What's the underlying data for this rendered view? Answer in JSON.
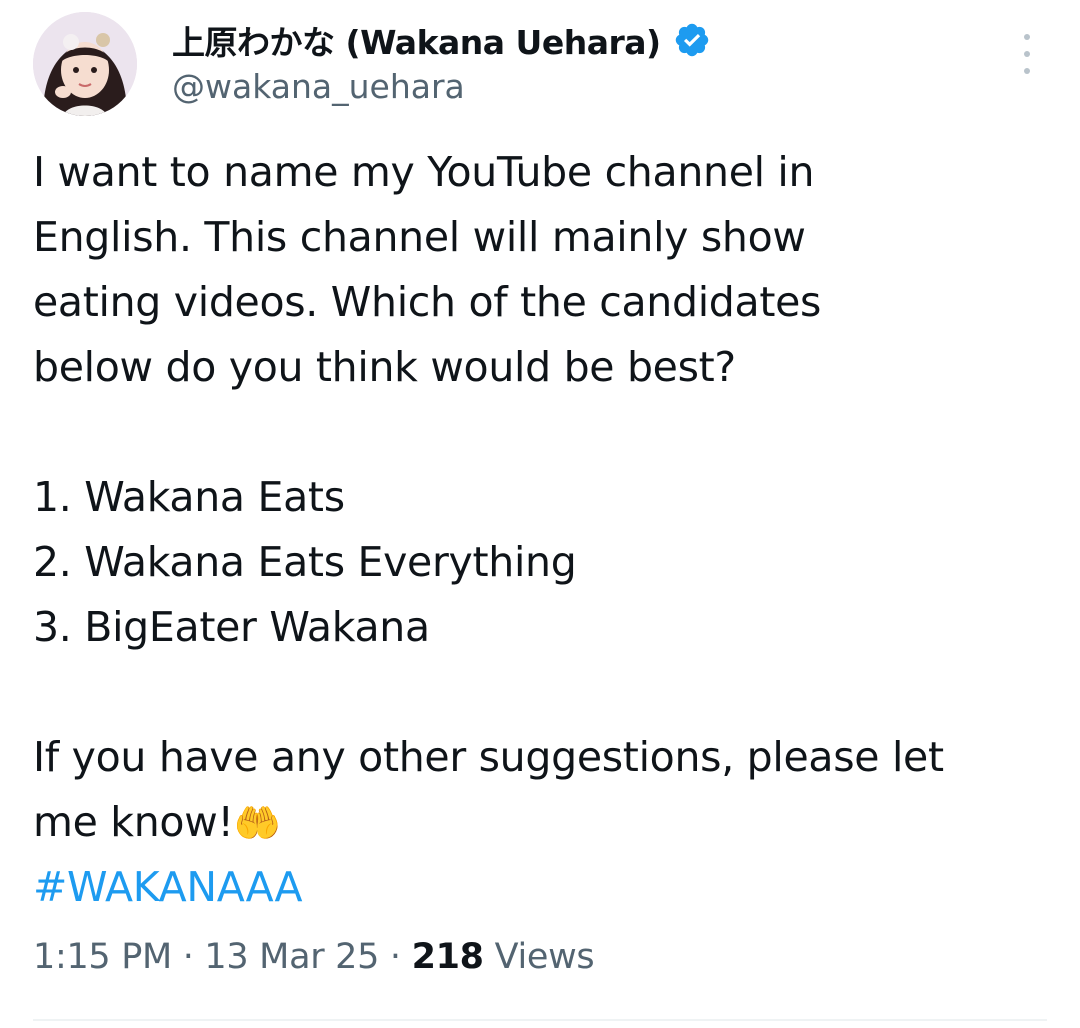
{
  "author": {
    "display_name": "上原わかな (Wakana Uehara)",
    "handle": "@wakana_uehara",
    "verified": true,
    "avatar_icon": "profile-photo",
    "verified_icon": "verified-badge-icon"
  },
  "tweet": {
    "lines": [
      "I want to name my YouTube channel in",
      "English. This channel will mainly show",
      "eating videos. Which of the candidates",
      "below do you think would be best?"
    ],
    "options": [
      "1. Wakana Eats",
      "2. Wakana Eats Everything",
      "3. BigEater Wakana"
    ],
    "closing_line_1": "If you have any other suggestions, please let",
    "closing_line_2": "me know!",
    "closing_emoji": "🤲",
    "hashtag": "#WAKANAAA"
  },
  "meta": {
    "time": "1:15 PM",
    "separator": " · ",
    "date": "13 Mar 25",
    "views_count": "218",
    "views_label": " Views"
  },
  "colors": {
    "text": "#0f1419",
    "secondary": "#536471",
    "link": "#1d9bf0",
    "verified": "#1d9bf0"
  }
}
